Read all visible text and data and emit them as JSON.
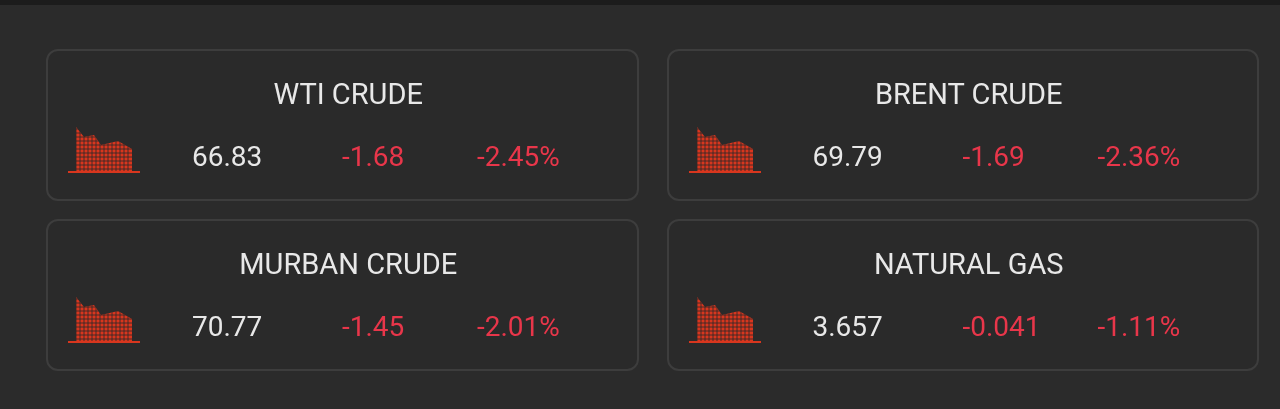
{
  "quotes": [
    {
      "name": "WTI CRUDE",
      "price": "66.83",
      "change": "-1.68",
      "percent": "-2.45%",
      "falling": true
    },
    {
      "name": "BRENT CRUDE",
      "price": "69.79",
      "change": "-1.69",
      "percent": "-2.36%",
      "falling": true
    },
    {
      "name": "MURBAN CRUDE",
      "price": "70.77",
      "change": "-1.45",
      "percent": "-2.01%",
      "falling": true
    },
    {
      "name": "NATURAL GAS",
      "price": "3.657",
      "change": "-0.041",
      "percent": "-1.11%",
      "falling": true
    }
  ]
}
